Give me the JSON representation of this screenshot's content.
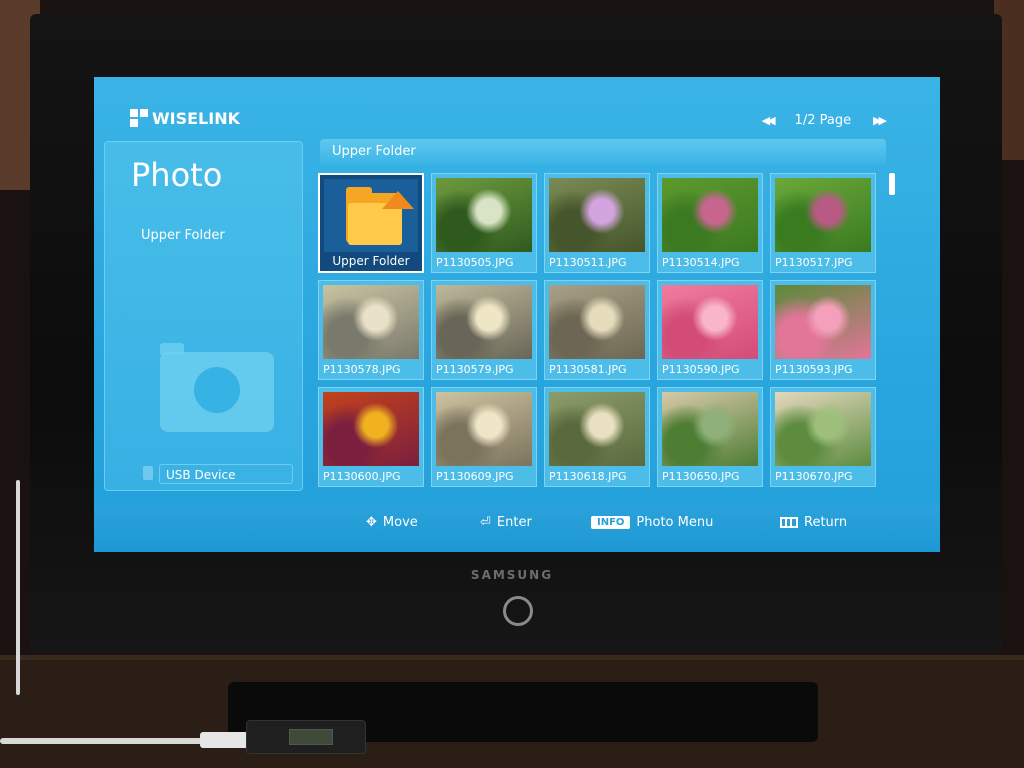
{
  "app": {
    "logo_text": "WISELINK",
    "pager_text": "1/2 Page",
    "prev_page_icon": "double-left-arrow",
    "next_page_icon": "double-right-arrow"
  },
  "left_panel": {
    "title": "Photo",
    "current_folder": "Upper Folder",
    "device_label": "USB Device",
    "device_icon": "usb-device-icon",
    "watermark_icon": "camera-icon"
  },
  "breadcrumb": "Upper Folder",
  "grid": {
    "items": [
      {
        "label": "Upper Folder",
        "kind": "folder",
        "selected": true
      },
      {
        "label": "P1130505.JPG",
        "kind": "photo",
        "palette": [
          "#6d9a3e",
          "#d9e4c6",
          "#2f5a1e"
        ]
      },
      {
        "label": "P1130511.JPG",
        "kind": "photo",
        "palette": [
          "#7a8b55",
          "#d3a4e0",
          "#46562c"
        ]
      },
      {
        "label": "P1130514.JPG",
        "kind": "photo",
        "palette": [
          "#5c9a2e",
          "#c8658f",
          "#3c7a21"
        ]
      },
      {
        "label": "P1130517.JPG",
        "kind": "photo",
        "palette": [
          "#6aa83a",
          "#b85a84",
          "#3a7b20"
        ]
      },
      {
        "label": "P1130578.JPG",
        "kind": "photo",
        "palette": [
          "#c9c2a2",
          "#e9e2c8",
          "#7a7a6c"
        ]
      },
      {
        "label": "P1130579.JPG",
        "kind": "photo",
        "palette": [
          "#bdb89a",
          "#efe6c6",
          "#6a6657"
        ]
      },
      {
        "label": "P1130581.JPG",
        "kind": "photo",
        "palette": [
          "#a9a186",
          "#e5dcbc",
          "#6d6653"
        ]
      },
      {
        "label": "P1130590.JPG",
        "kind": "photo",
        "palette": [
          "#f07b9e",
          "#f9b6c9",
          "#d24c77"
        ]
      },
      {
        "label": "P1130593.JPG",
        "kind": "photo",
        "palette": [
          "#5b8a3a",
          "#f4a0bb",
          "#e27699"
        ]
      },
      {
        "label": "P1130600.JPG",
        "kind": "photo",
        "palette": [
          "#c2421c",
          "#f0b21f",
          "#7b1f3e"
        ]
      },
      {
        "label": "P1130609.JPG",
        "kind": "photo",
        "palette": [
          "#cdc3a0",
          "#efe5c7",
          "#7b735c"
        ]
      },
      {
        "label": "P1130618.JPG",
        "kind": "photo",
        "palette": [
          "#8c9c6a",
          "#e9dfc1",
          "#5a6a3d"
        ]
      },
      {
        "label": "P1130650.JPG",
        "kind": "photo",
        "palette": [
          "#d8c9a8",
          "#8fb07a",
          "#4e7d34"
        ]
      },
      {
        "label": "P1130670.JPG",
        "kind": "photo",
        "palette": [
          "#e3d8bd",
          "#9ec07c",
          "#5d8c3f"
        ]
      }
    ]
  },
  "hints": {
    "move": "Move",
    "enter": "Enter",
    "info_key": "INFO",
    "photo_menu": "Photo Menu",
    "return": "Return"
  },
  "tv": {
    "brand": "SAMSUNG"
  },
  "colors": {
    "screen_bg": "#2aa6df",
    "selected_bg": "#124a7e",
    "cell_bg": "#4bbde8"
  }
}
